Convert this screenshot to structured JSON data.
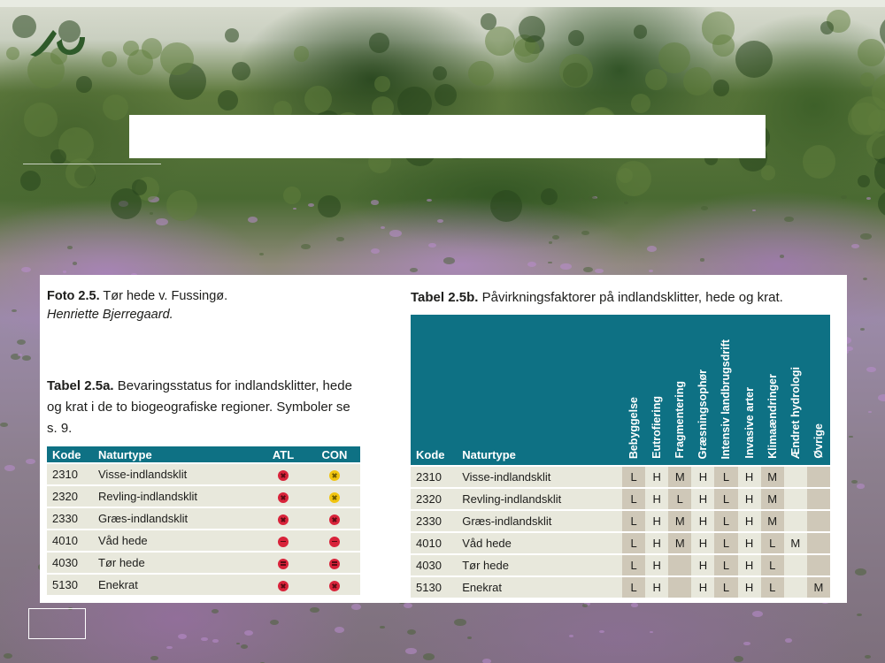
{
  "caption": {
    "photo_label": "Foto 2.5.",
    "photo_text": "Tør hede v. Fussingø.",
    "credit": "Henriette Bjerregaard."
  },
  "table_a": {
    "label": "Tabel 2.5a.",
    "title": "Bevaringsstatus for indlandsklitter, hede og krat i de to biogeografiske regioner. Symboler se s. 9.",
    "headers": [
      "Kode",
      "Naturtype",
      "ATL",
      "CON"
    ],
    "rows": [
      {
        "code": "2310",
        "name": "Visse-indlandsklit",
        "atl": "red-x",
        "con": "yellow-x"
      },
      {
        "code": "2320",
        "name": "Revling-indlandsklit",
        "atl": "red-x",
        "con": "yellow-x"
      },
      {
        "code": "2330",
        "name": "Græs-indlandsklit",
        "atl": "red-x",
        "con": "red-x"
      },
      {
        "code": "4010",
        "name": "Våd hede",
        "atl": "red-minus",
        "con": "red-minus"
      },
      {
        "code": "4030",
        "name": "Tør hede",
        "atl": "red-equals",
        "con": "red-equals"
      },
      {
        "code": "5130",
        "name": "Enekrat",
        "atl": "red-x",
        "con": "red-x"
      }
    ]
  },
  "table_b": {
    "label": "Tabel 2.5b.",
    "title": "Påvirkningsfaktorer på indlandsklitter, hede og krat.",
    "headers": {
      "code": "Kode",
      "name": "Naturtype",
      "factors": [
        "Bebyggelse",
        "Eutrofiering",
        "Fragmentering",
        "Græsningsophør",
        "Intensiv landbrugsdrift",
        "Invasive arter",
        "Klimaændringer",
        "Ændret hydrologi",
        "Øvrige"
      ]
    },
    "rows": [
      {
        "code": "2310",
        "name": "Visse-indlandsklit",
        "values": [
          "L",
          "H",
          "M",
          "H",
          "L",
          "H",
          "M",
          "",
          ""
        ]
      },
      {
        "code": "2320",
        "name": "Revling-indlandsklit",
        "values": [
          "L",
          "H",
          "L",
          "H",
          "L",
          "H",
          "M",
          "",
          ""
        ]
      },
      {
        "code": "2330",
        "name": "Græs-indlandsklit",
        "values": [
          "L",
          "H",
          "M",
          "H",
          "L",
          "H",
          "M",
          "",
          ""
        ]
      },
      {
        "code": "4010",
        "name": "Våd hede",
        "values": [
          "L",
          "H",
          "M",
          "H",
          "L",
          "H",
          "L",
          "M",
          ""
        ]
      },
      {
        "code": "4030",
        "name": "Tør hede",
        "values": [
          "L",
          "H",
          "",
          "H",
          "L",
          "H",
          "L",
          "",
          ""
        ]
      },
      {
        "code": "5130",
        "name": "Enekrat",
        "values": [
          "L",
          "H",
          "",
          "H",
          "L",
          "H",
          "L",
          "",
          "M"
        ]
      }
    ]
  },
  "colors": {
    "header_teal": "#0e7184",
    "cell_light": "#e8e8dc",
    "cell_dark": "#cfc8b8",
    "status_red": "#d8233a",
    "status_yellow": "#f1c40f",
    "logo_green": "#2f5a2a"
  },
  "icons": {
    "logo": "au-wave-logo",
    "status_symbols": [
      "red-x",
      "yellow-x",
      "red-minus",
      "red-equals"
    ]
  }
}
